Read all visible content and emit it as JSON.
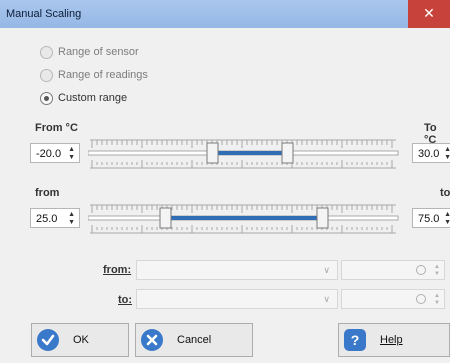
{
  "window": {
    "title": "Manual Scaling",
    "close_glyph": "✕"
  },
  "range_options": [
    {
      "label": "Range of sensor",
      "checked": false
    },
    {
      "label": "Range of readings",
      "checked": false
    },
    {
      "label": "Custom range",
      "checked": true
    }
  ],
  "temperature": {
    "from_label": "From °C",
    "to_label": "To °C",
    "from_value": "-20.0",
    "to_value": "30.0"
  },
  "secondary": {
    "from_label": "from",
    "to_label": "to",
    "from_value": "25.0",
    "to_value": "75.0"
  },
  "date_filter": {
    "from_label": "from:",
    "to_label": "to:"
  },
  "buttons": {
    "ok": "OK",
    "cancel": "Cancel",
    "help": "Help"
  },
  "colors": {
    "title_bar": "#a9c7ee",
    "close_button": "#c7423a",
    "slider_fill": "#2f6db5",
    "icon_blue": "#3a78c9"
  }
}
